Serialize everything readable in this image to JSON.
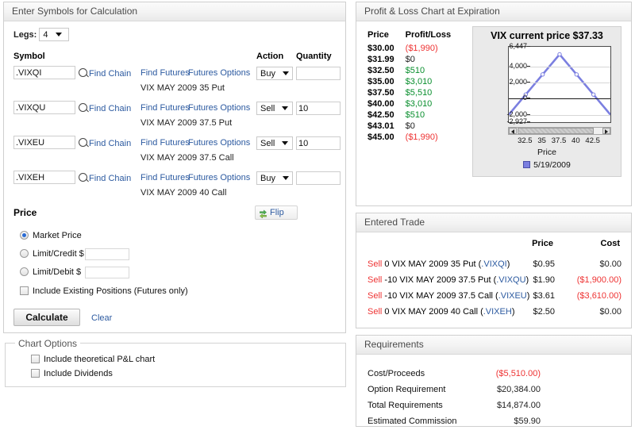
{
  "left": {
    "header": "Enter Symbols for Calculation",
    "legs": {
      "label": "Legs:",
      "value": "4"
    },
    "columns": {
      "symbol": "Symbol",
      "action": "Action",
      "quantity": "Quantity"
    },
    "links": {
      "find_chain": "Find Chain",
      "find_futures": "Find Futures",
      "futures_options": "Futures Options"
    },
    "rows": [
      {
        "symbol": ".VIXQI",
        "action": "Buy",
        "quantity": "",
        "description": "VIX MAY 2009 35 Put"
      },
      {
        "symbol": ".VIXQU",
        "action": "Sell",
        "quantity": "10",
        "description": "VIX MAY 2009 37.5 Put"
      },
      {
        "symbol": ".VIXEU",
        "action": "Sell",
        "quantity": "10",
        "description": "VIX MAY 2009 37.5 Call"
      },
      {
        "symbol": ".VIXEH",
        "action": "Buy",
        "quantity": "",
        "description": "VIX MAY 2009 40 Call"
      }
    ],
    "price": {
      "title": "Price",
      "flip_label": "Flip",
      "market_price": "Market Price",
      "limit_credit": "Limit/Credit $",
      "limit_debit": "Limit/Debit $",
      "limit_credit_value": "",
      "limit_debit_value": "",
      "include_existing": "Include Existing Positions (Futures only)",
      "calculate": "Calculate",
      "clear": "Clear"
    },
    "chart_options": {
      "legend": "Chart Options",
      "include_theoretical": "Include theoretical P&L chart",
      "include_dividends": "Include Dividends"
    }
  },
  "pl_panel": {
    "header": "Profit & Loss Chart at Expiration",
    "columns": {
      "price": "Price",
      "profit_loss": "Profit/Loss"
    },
    "rows": [
      {
        "price": "$30.00",
        "pl": "($1,990)",
        "tone": "neg"
      },
      {
        "price": "$31.99",
        "pl": "$0",
        "tone": "zero"
      },
      {
        "price": "$32.50",
        "pl": "$510",
        "tone": "pos"
      },
      {
        "price": "$35.00",
        "pl": "$3,010",
        "tone": "pos"
      },
      {
        "price": "$37.50",
        "pl": "$5,510",
        "tone": "pos"
      },
      {
        "price": "$40.00",
        "pl": "$3,010",
        "tone": "pos"
      },
      {
        "price": "$42.50",
        "pl": "$510",
        "tone": "pos"
      },
      {
        "price": "$43.01",
        "pl": "$0",
        "tone": "zero"
      },
      {
        "price": "$45.00",
        "pl": "($1,990)",
        "tone": "neg"
      }
    ]
  },
  "chart_data": {
    "type": "line",
    "title": "VIX current price $37.33",
    "xlabel": "Price",
    "ylabel": "",
    "x": [
      30.0,
      31.99,
      32.5,
      35.0,
      37.5,
      40.0,
      42.5,
      43.01,
      45.0
    ],
    "values": [
      -1990,
      0,
      510,
      3010,
      5510,
      3010,
      510,
      0,
      -1990
    ],
    "series": [
      {
        "name": "5/19/2009",
        "color": "#7b7fe0",
        "values": [
          -1990,
          0,
          510,
          3010,
          5510,
          3010,
          510,
          0,
          -1990
        ]
      }
    ],
    "markers_x": [
      32.5,
      35.0,
      37.5,
      40.0,
      42.5
    ],
    "markers_y": [
      510,
      3010,
      5510,
      3010,
      510
    ],
    "ytick_labels": [
      "6,447",
      "4,000",
      "2,000",
      "0",
      "-2,000",
      "-2,927"
    ],
    "ytick_values": [
      6447,
      4000,
      2000,
      0,
      -2000,
      -2927
    ],
    "ylim": [
      -2927,
      6447
    ],
    "xtick_labels": [
      "32.5",
      "35",
      "37.5",
      "40",
      "42.5"
    ],
    "xtick_values": [
      32.5,
      35,
      37.5,
      40,
      42.5
    ],
    "xlim": [
      30.0,
      45.0
    ],
    "grid": true,
    "legend_position": "bottom",
    "legend_entries": [
      "5/19/2009"
    ],
    "current_price": "$37.33",
    "has_scrollbar": true
  },
  "trade": {
    "header": "Entered Trade",
    "columns": {
      "price": "Price",
      "cost": "Cost"
    },
    "rows": [
      {
        "action": "Sell",
        "detail": "0 VIX MAY 2009 35 Put (",
        "symbol": ".VIXQI",
        "close": ")",
        "price": "$0.95",
        "cost": "$0.00",
        "cost_tone": "zero"
      },
      {
        "action": "Sell",
        "detail": "-10 VIX MAY 2009 37.5 Put (",
        "symbol": ".VIXQU",
        "close": ")",
        "price": "$1.90",
        "cost": "($1,900.00)",
        "cost_tone": "neg"
      },
      {
        "action": "Sell",
        "detail": "-10 VIX MAY 2009 37.5 Call (",
        "symbol": ".VIXEU",
        "close": ")",
        "price": "$3.61",
        "cost": "($3,610.00)",
        "cost_tone": "neg"
      },
      {
        "action": "Sell",
        "detail": "0 VIX MAY 2009 40 Call (",
        "symbol": ".VIXEH",
        "close": ")",
        "price": "$2.50",
        "cost": "$0.00",
        "cost_tone": "zero"
      }
    ]
  },
  "requirements": {
    "header": "Requirements",
    "rows": [
      {
        "label": "Cost/Proceeds",
        "value": "($5,510.00)",
        "tone": "neg"
      },
      {
        "label": "Option Requirement",
        "value": "$20,384.00",
        "tone": "zero"
      },
      {
        "label": "Total Requirements",
        "value": "$14,874.00",
        "tone": "zero"
      },
      {
        "label": "Estimated Commission",
        "value": "$59.90",
        "tone": "zero"
      }
    ]
  },
  "colors": {
    "negative": "#ee3333",
    "positive": "#0a8f2e",
    "link": "#2c5aa0",
    "chart_line": "#7b7fe0"
  }
}
